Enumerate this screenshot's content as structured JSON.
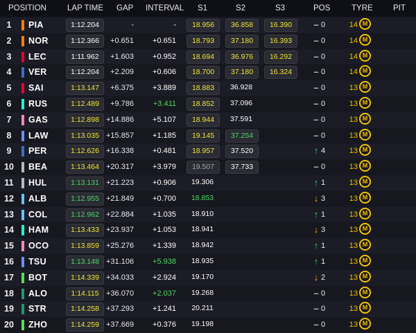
{
  "header": {
    "position": "POSITION",
    "lap_time": "LAP TIME",
    "gap": "GAP",
    "interval": "INTERVAL",
    "s1": "S1",
    "s2": "S2",
    "s3": "S3",
    "pos": "POS",
    "tyre": "TYRE",
    "pit": "PIT"
  },
  "colors": {
    "personal_best": "#f2e531",
    "overall_best": "#4cd964",
    "tyre_medium": "#f2c200",
    "pos_up": "#3fd467",
    "pos_down": "#f5b800"
  },
  "rows": [
    {
      "pos": "1",
      "driver": "PIA",
      "team_color": "#ff8000",
      "lap": "1:12.204",
      "lap_color": "white",
      "gap": "-",
      "interval": "-",
      "interval_color": "white",
      "s1": "18.956",
      "s1_color": "yellow",
      "s1_box": true,
      "s2": "36.858",
      "s2_color": "yellow",
      "s2_box": true,
      "s3": "16.390",
      "s3_color": "yellow",
      "s3_box": true,
      "dir": "dash",
      "change": "0",
      "tyre_laps": "14",
      "tyre": "M"
    },
    {
      "pos": "2",
      "driver": "NOR",
      "team_color": "#ff8000",
      "lap": "1:12.366",
      "lap_color": "white",
      "gap": "+0.651",
      "interval": "+0.651",
      "interval_color": "white",
      "s1": "18.793",
      "s1_color": "yellow",
      "s1_box": true,
      "s2": "37.180",
      "s2_color": "yellow",
      "s2_box": true,
      "s3": "16.393",
      "s3_color": "yellow",
      "s3_box": true,
      "dir": "dash",
      "change": "0",
      "tyre_laps": "14",
      "tyre": "M"
    },
    {
      "pos": "3",
      "driver": "LEC",
      "team_color": "#e8002d",
      "lap": "1:11.962",
      "lap_color": "white",
      "gap": "+1.603",
      "interval": "+0.952",
      "interval_color": "white",
      "s1": "18.694",
      "s1_color": "yellow",
      "s1_box": true,
      "s2": "36.976",
      "s2_color": "yellow",
      "s2_box": true,
      "s3": "16.292",
      "s3_color": "yellow",
      "s3_box": true,
      "dir": "dash",
      "change": "0",
      "tyre_laps": "14",
      "tyre": "M"
    },
    {
      "pos": "4",
      "driver": "VER",
      "team_color": "#3671c6",
      "lap": "1:12.204",
      "lap_color": "white",
      "gap": "+2.209",
      "interval": "+0.606",
      "interval_color": "white",
      "s1": "18.700",
      "s1_color": "yellow",
      "s1_box": true,
      "s2": "37.180",
      "s2_color": "yellow",
      "s2_box": true,
      "s3": "16.324",
      "s3_color": "yellow",
      "s3_box": true,
      "dir": "dash",
      "change": "0",
      "tyre_laps": "14",
      "tyre": "M"
    },
    {
      "pos": "5",
      "driver": "SAI",
      "team_color": "#e8002d",
      "lap": "1:13.147",
      "lap_color": "yellow",
      "gap": "+6.375",
      "interval": "+3.889",
      "interval_color": "white",
      "s1": "18.883",
      "s1_color": "yellow",
      "s1_box": true,
      "s2": "36.928",
      "s2_color": "white",
      "s2_box": false,
      "s3": "",
      "s3_color": "white",
      "s3_box": false,
      "dir": "dash",
      "change": "0",
      "tyre_laps": "13",
      "tyre": "M"
    },
    {
      "pos": "6",
      "driver": "RUS",
      "team_color": "#27f4d2",
      "lap": "1:12.489",
      "lap_color": "yellow",
      "gap": "+9.786",
      "interval": "+3.411",
      "interval_color": "green",
      "s1": "18.852",
      "s1_color": "yellow",
      "s1_box": true,
      "s2": "37.096",
      "s2_color": "white",
      "s2_box": false,
      "s3": "",
      "s3_color": "white",
      "s3_box": false,
      "dir": "dash",
      "change": "0",
      "tyre_laps": "13",
      "tyre": "M"
    },
    {
      "pos": "7",
      "driver": "GAS",
      "team_color": "#ff87bc",
      "lap": "1:12.898",
      "lap_color": "yellow",
      "gap": "+14.886",
      "interval": "+5.107",
      "interval_color": "white",
      "s1": "18.944",
      "s1_color": "yellow",
      "s1_box": true,
      "s2": "37.591",
      "s2_color": "white",
      "s2_box": false,
      "s3": "",
      "s3_color": "white",
      "s3_box": false,
      "dir": "dash",
      "change": "0",
      "tyre_laps": "13",
      "tyre": "M"
    },
    {
      "pos": "8",
      "driver": "LAW",
      "team_color": "#6692ff",
      "lap": "1:13.035",
      "lap_color": "yellow",
      "gap": "+15.857",
      "interval": "+1.185",
      "interval_color": "white",
      "s1": "19.145",
      "s1_color": "yellow",
      "s1_box": true,
      "s2": "37.254",
      "s2_color": "green",
      "s2_box": true,
      "s3": "",
      "s3_color": "white",
      "s3_box": false,
      "dir": "dash",
      "change": "0",
      "tyre_laps": "13",
      "tyre": "M"
    },
    {
      "pos": "9",
      "driver": "PER",
      "team_color": "#3671c6",
      "lap": "1:12.626",
      "lap_color": "yellow",
      "gap": "+16.338",
      "interval": "+0.481",
      "interval_color": "white",
      "s1": "18.957",
      "s1_color": "yellow",
      "s1_box": true,
      "s2": "37.520",
      "s2_color": "white",
      "s2_box": true,
      "s3": "",
      "s3_color": "white",
      "s3_box": false,
      "dir": "up",
      "change": "4",
      "tyre_laps": "13",
      "tyre": "M"
    },
    {
      "pos": "10",
      "driver": "BEA",
      "team_color": "#b6babd",
      "lap": "1:13.464",
      "lap_color": "yellow",
      "gap": "+20.317",
      "interval": "+3.979",
      "interval_color": "white",
      "s1": "19.507",
      "s1_color": "grey",
      "s1_box": true,
      "s2": "37.733",
      "s2_color": "white",
      "s2_box": true,
      "s3": "",
      "s3_color": "white",
      "s3_box": false,
      "dir": "dash",
      "change": "0",
      "tyre_laps": "13",
      "tyre": "M"
    },
    {
      "pos": "11",
      "driver": "HUL",
      "team_color": "#b6babd",
      "lap": "1:13.131",
      "lap_color": "green",
      "gap": "+21.223",
      "interval": "+0.906",
      "interval_color": "white",
      "s1": "19.306",
      "s1_color": "white",
      "s1_box": false,
      "s2": "",
      "s2_color": "white",
      "s2_box": false,
      "s3": "",
      "s3_color": "white",
      "s3_box": false,
      "dir": "up",
      "change": "1",
      "tyre_laps": "13",
      "tyre": "M"
    },
    {
      "pos": "12",
      "driver": "ALB",
      "team_color": "#64c4ff",
      "lap": "1:12.955",
      "lap_color": "green",
      "gap": "+21.849",
      "interval": "+0.700",
      "interval_color": "white",
      "s1": "18.853",
      "s1_color": "green",
      "s1_box": false,
      "s2": "",
      "s2_color": "white",
      "s2_box": false,
      "s3": "",
      "s3_color": "white",
      "s3_box": false,
      "dir": "down",
      "change": "3",
      "tyre_laps": "13",
      "tyre": "M"
    },
    {
      "pos": "13",
      "driver": "COL",
      "team_color": "#64c4ff",
      "lap": "1:12.962",
      "lap_color": "green",
      "gap": "+22.884",
      "interval": "+1.035",
      "interval_color": "white",
      "s1": "18.910",
      "s1_color": "white",
      "s1_box": false,
      "s2": "",
      "s2_color": "white",
      "s2_box": false,
      "s3": "",
      "s3_color": "white",
      "s3_box": false,
      "dir": "up",
      "change": "1",
      "tyre_laps": "13",
      "tyre": "M"
    },
    {
      "pos": "14",
      "driver": "HAM",
      "team_color": "#27f4d2",
      "lap": "1:13.433",
      "lap_color": "yellow",
      "gap": "+23.937",
      "interval": "+1.053",
      "interval_color": "white",
      "s1": "18.941",
      "s1_color": "white",
      "s1_box": false,
      "s2": "",
      "s2_color": "white",
      "s2_box": false,
      "s3": "",
      "s3_color": "white",
      "s3_box": false,
      "dir": "down",
      "change": "3",
      "tyre_laps": "13",
      "tyre": "M"
    },
    {
      "pos": "15",
      "driver": "OCO",
      "team_color": "#ff87bc",
      "lap": "1:13.859",
      "lap_color": "yellow",
      "gap": "+25.276",
      "interval": "+1.339",
      "interval_color": "white",
      "s1": "18.942",
      "s1_color": "white",
      "s1_box": false,
      "s2": "",
      "s2_color": "white",
      "s2_box": false,
      "s3": "",
      "s3_color": "white",
      "s3_box": false,
      "dir": "up",
      "change": "1",
      "tyre_laps": "13",
      "tyre": "M"
    },
    {
      "pos": "16",
      "driver": "TSU",
      "team_color": "#6692ff",
      "lap": "1:13.148",
      "lap_color": "green",
      "gap": "+31.106",
      "interval": "+5.938",
      "interval_color": "green",
      "s1": "18.935",
      "s1_color": "white",
      "s1_box": false,
      "s2": "",
      "s2_color": "white",
      "s2_box": false,
      "s3": "",
      "s3_color": "white",
      "s3_box": false,
      "dir": "up",
      "change": "1",
      "tyre_laps": "13",
      "tyre": "M"
    },
    {
      "pos": "17",
      "driver": "BOT",
      "team_color": "#52e252",
      "lap": "1:14.339",
      "lap_color": "yellow",
      "gap": "+34.033",
      "interval": "+2.924",
      "interval_color": "white",
      "s1": "19.170",
      "s1_color": "white",
      "s1_box": false,
      "s2": "",
      "s2_color": "white",
      "s2_box": false,
      "s3": "",
      "s3_color": "white",
      "s3_box": false,
      "dir": "down",
      "change": "2",
      "tyre_laps": "13",
      "tyre": "M"
    },
    {
      "pos": "18",
      "driver": "ALO",
      "team_color": "#229971",
      "lap": "1:14.115",
      "lap_color": "yellow",
      "gap": "+36.070",
      "interval": "+2.037",
      "interval_color": "green",
      "s1": "19.268",
      "s1_color": "white",
      "s1_box": false,
      "s2": "",
      "s2_color": "white",
      "s2_box": false,
      "s3": "",
      "s3_color": "white",
      "s3_box": false,
      "dir": "dash",
      "change": "0",
      "tyre_laps": "13",
      "tyre": "M"
    },
    {
      "pos": "19",
      "driver": "STR",
      "team_color": "#229971",
      "lap": "1:14.258",
      "lap_color": "yellow",
      "gap": "+37.293",
      "interval": "+1.241",
      "interval_color": "white",
      "s1": "20.211",
      "s1_color": "white",
      "s1_box": false,
      "s2": "",
      "s2_color": "white",
      "s2_box": false,
      "s3": "",
      "s3_color": "white",
      "s3_box": false,
      "dir": "dash",
      "change": "0",
      "tyre_laps": "13",
      "tyre": "M"
    },
    {
      "pos": "20",
      "driver": "ZHO",
      "team_color": "#52e252",
      "lap": "1:14.259",
      "lap_color": "yellow",
      "gap": "+37.669",
      "interval": "+0.376",
      "interval_color": "white",
      "s1": "19.198",
      "s1_color": "white",
      "s1_box": false,
      "s2": "",
      "s2_color": "white",
      "s2_box": false,
      "s3": "",
      "s3_color": "white",
      "s3_box": false,
      "dir": "dash",
      "change": "0",
      "tyre_laps": "13",
      "tyre": "M"
    }
  ]
}
